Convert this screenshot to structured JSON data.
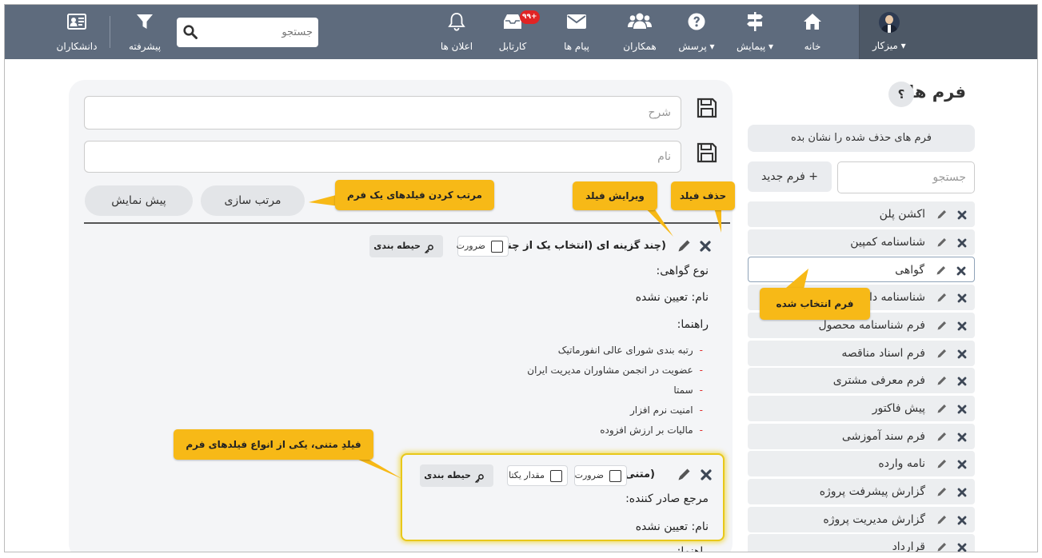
{
  "navbar": {
    "user_label": "میزکار ▾",
    "items": [
      {
        "label": "خانه",
        "icon": "home-icon"
      },
      {
        "label": "پیمایش ▾",
        "icon": "signpost-icon"
      },
      {
        "label": "پرسش ▾",
        "icon": "question-icon"
      },
      {
        "label": "همکاران",
        "icon": "users-icon"
      },
      {
        "label": "پیام ها",
        "icon": "envelope-icon"
      },
      {
        "label": "کارتابل",
        "icon": "inbox-icon",
        "badge": "۹۹+"
      },
      {
        "label": "اعلان ها",
        "icon": "bell-icon"
      }
    ],
    "search_placeholder": "جستجو",
    "advanced_label": "پیشرفته",
    "scholars_label": "دانشکاران"
  },
  "sidebar": {
    "title": "فرم ها",
    "help": "؟",
    "show_deleted": "فرم های حذف شده را نشان بده",
    "search_placeholder": "جستجو",
    "new_form": "+ فرم جدید",
    "items": [
      {
        "name": "اکشن پلن"
      },
      {
        "name": "شناسنامه کمپین"
      },
      {
        "name": "گواهی",
        "selected": true
      },
      {
        "name": "شناسنامه دارایی"
      },
      {
        "name": "فرم شناسنامه محصول"
      },
      {
        "name": "فرم اسناد مناقصه"
      },
      {
        "name": "فرم معرفی مشتری"
      },
      {
        "name": "پیش فاکتور"
      },
      {
        "name": "فرم سند آموزشی"
      },
      {
        "name": "نامه وارده"
      },
      {
        "name": "گزارش پیشرفت پروژه"
      },
      {
        "name": "گزارش مدیریت پروژه"
      },
      {
        "name": "قرارداد"
      }
    ]
  },
  "editor": {
    "description_placeholder": "شرح",
    "name_placeholder": "نام",
    "sort_button": "مرتب سازی",
    "preview_button": "پیش نمایش",
    "field1": {
      "type_label": "(چند گزینه ای (انتخاب یک از چند))",
      "required_label": "ضرورت",
      "grouping_label": "حیطه بندی",
      "title": "نوع گواهی:",
      "name_line": "نام: تعیین نشده",
      "guide_label": "راهنما:",
      "options": [
        "رتبه بندی شورای عالی انفورماتیک",
        "عضویت در انجمن مشاوران مدیریت ایران",
        "سمتا",
        "امنیت نرم افزار",
        "مالیات بر ارزش افزوده"
      ]
    },
    "field2": {
      "type_label": "(متنی)",
      "required_label": "ضرورت",
      "unique_label": "مقدار یکتا",
      "grouping_label": "حیطه بندی",
      "title": "مرجع صادر کننده:",
      "name_line": "نام: تعیین نشده",
      "guide_label": "راهنما:"
    }
  },
  "callouts": {
    "delete_field": "حذف فیلد",
    "edit_field": "ویرایش فیلد",
    "sort_fields": "مرتب کردن فیلدهای یک فرم",
    "selected_form": "فرم انتخاب شده",
    "text_field": "فیلدِ متنی، یکی از انواع فیلدهای فرم"
  },
  "colors": {
    "navbar": "#5e6b7d",
    "navbar_user": "#4d5866",
    "callout": "#f7b917",
    "badge": "#e02424",
    "highlight": "#e8c81a"
  }
}
